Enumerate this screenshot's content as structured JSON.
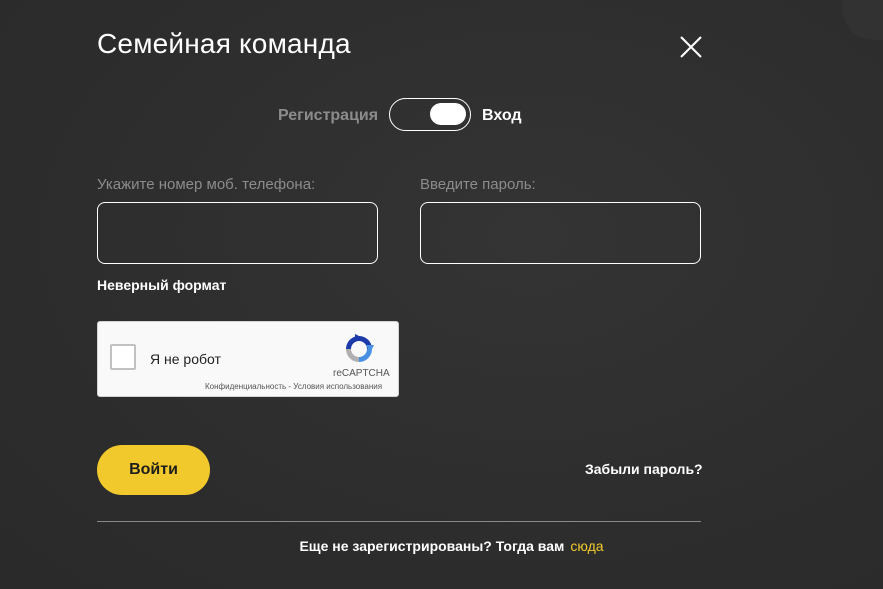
{
  "modal": {
    "title": "Семейная команда",
    "close_icon": "close-icon"
  },
  "toggle": {
    "left_label": "Регистрация",
    "right_label": "Вход",
    "state": "right"
  },
  "phone": {
    "label": "Укажите номер моб. телефона:",
    "value": "",
    "placeholder": ""
  },
  "password": {
    "label": "Введите пароль:",
    "value": "",
    "placeholder": ""
  },
  "error": {
    "text": "Неверный формат"
  },
  "captcha": {
    "label": "Я не робот",
    "brand": "reCAPTCHA",
    "privacy": "Конфиденциальность",
    "separator": " - ",
    "terms": "Условия использования"
  },
  "actions": {
    "login_label": "Войти",
    "forgot_label": "Забыли пароль?"
  },
  "footer": {
    "prompt": "Еще не зарегистрированы? Тогда вам",
    "link": "сюда"
  },
  "colors": {
    "accent": "#f1c92c",
    "background": "#2e2e2e",
    "muted_text": "#8c8c8c"
  }
}
